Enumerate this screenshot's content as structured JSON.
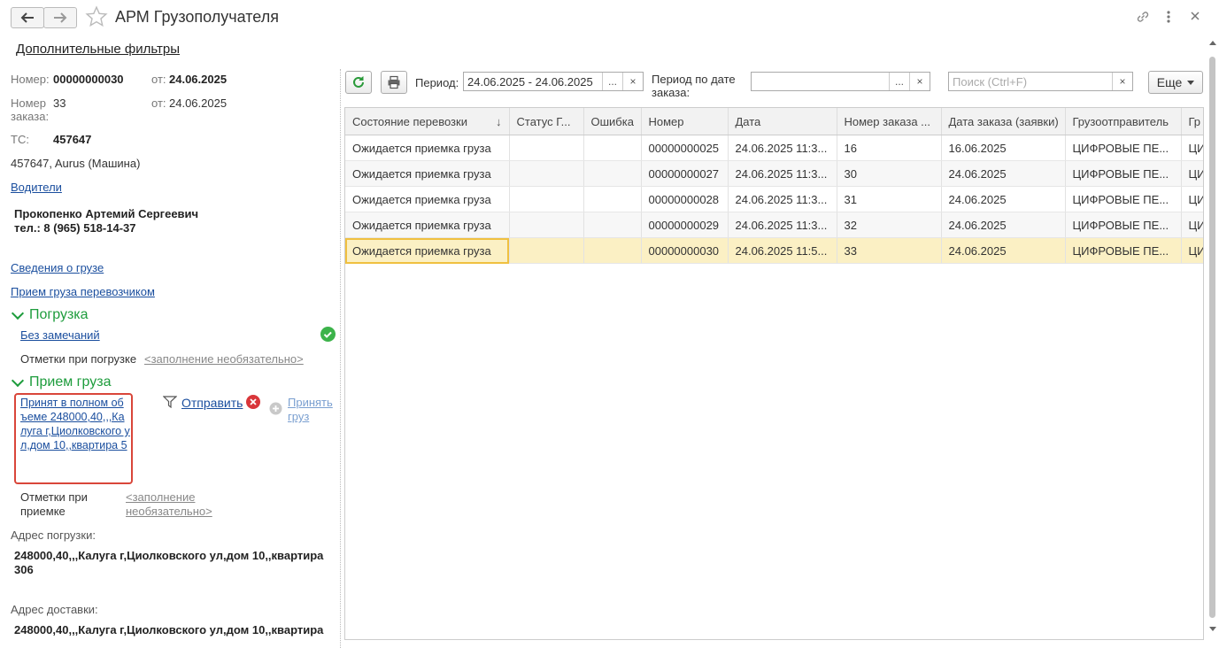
{
  "window": {
    "title": "АРМ Грузополучателя"
  },
  "filters_link": "Дополнительные фильтры",
  "info": {
    "number_label": "Номер:",
    "number_value": "00000000030",
    "from_label": "от:",
    "from_value": "24.06.2025",
    "order_label": "Номер заказа:",
    "order_value": "33",
    "order_from_label": "от:",
    "order_from_value": "24.06.2025",
    "ts_label": "ТС:",
    "ts_value": "457647",
    "vehicle": "457647, Aurus (Машина)",
    "drivers_link": "Водители",
    "driver_name": "Прокопенко Артемий Сергеевич",
    "driver_phone": "тел.: 8 (965) 518-14-37",
    "cargo_info_link": "Сведения о грузе",
    "carrier_receipt_link": "Прием груза перевозчиком"
  },
  "loading": {
    "title": "Погрузка",
    "status_link": "Без замечаний",
    "marks_label": "Отметки при погрузке",
    "marks_value": "<заполнение необязательно>"
  },
  "receipt": {
    "title": "Прием груза",
    "accepted_link": "Принят в полном объеме 248000,40,,,Калуга г,Циолковского ул,дом 10,,квартира 5",
    "send_link": "Отправить",
    "accept_label": "Принять груз",
    "marks_label": "Отметки при приемке",
    "marks_value": "<заполнение необязательно>"
  },
  "addresses": {
    "loading_label": "Адрес погрузки:",
    "loading_value": "248000,40,,,Калуга г,Циолковского ул,дом 10,,квартира 306",
    "delivery_label": "Адрес доставки:",
    "delivery_value": "248000,40,,,Калуга г,Циолковского ул,дом 10,,квартира"
  },
  "toolbar": {
    "period_label": "Период:",
    "period_value": "24.06.2025 - 24.06.2025",
    "order_period_label": "Период по дате заказа:",
    "order_period_value": "",
    "search_placeholder": "Поиск (Ctrl+F)",
    "more_label": "Еще",
    "dots": "...",
    "clear": "×"
  },
  "table": {
    "columns": [
      "Состояние перевозки",
      "Статус Г...",
      "Ошибка",
      "Номер",
      "Дата",
      "Номер заказа ...",
      "Дата заказа (заявки)",
      "Грузоотправитель",
      "Гр"
    ],
    "rows": [
      [
        "Ожидается приемка груза",
        "",
        "",
        "00000000025",
        "24.06.2025 11:3...",
        "16",
        "16.06.2025",
        "ЦИФРОВЫЕ ПЕ...",
        "ЦИ"
      ],
      [
        "Ожидается приемка груза",
        "",
        "",
        "00000000027",
        "24.06.2025 11:3...",
        "30",
        "24.06.2025",
        "ЦИФРОВЫЕ ПЕ...",
        "ЦИ"
      ],
      [
        "Ожидается приемка груза",
        "",
        "",
        "00000000028",
        "24.06.2025 11:3...",
        "31",
        "24.06.2025",
        "ЦИФРОВЫЕ ПЕ...",
        "ЦИ"
      ],
      [
        "Ожидается приемка груза",
        "",
        "",
        "00000000029",
        "24.06.2025 11:3...",
        "32",
        "24.06.2025",
        "ЦИФРОВЫЕ ПЕ...",
        "ЦИ"
      ],
      [
        "Ожидается приемка груза",
        "",
        "",
        "00000000030",
        "24.06.2025 11:5...",
        "33",
        "24.06.2025",
        "ЦИФРОВЫЕ ПЕ...",
        "ЦИ"
      ]
    ]
  }
}
